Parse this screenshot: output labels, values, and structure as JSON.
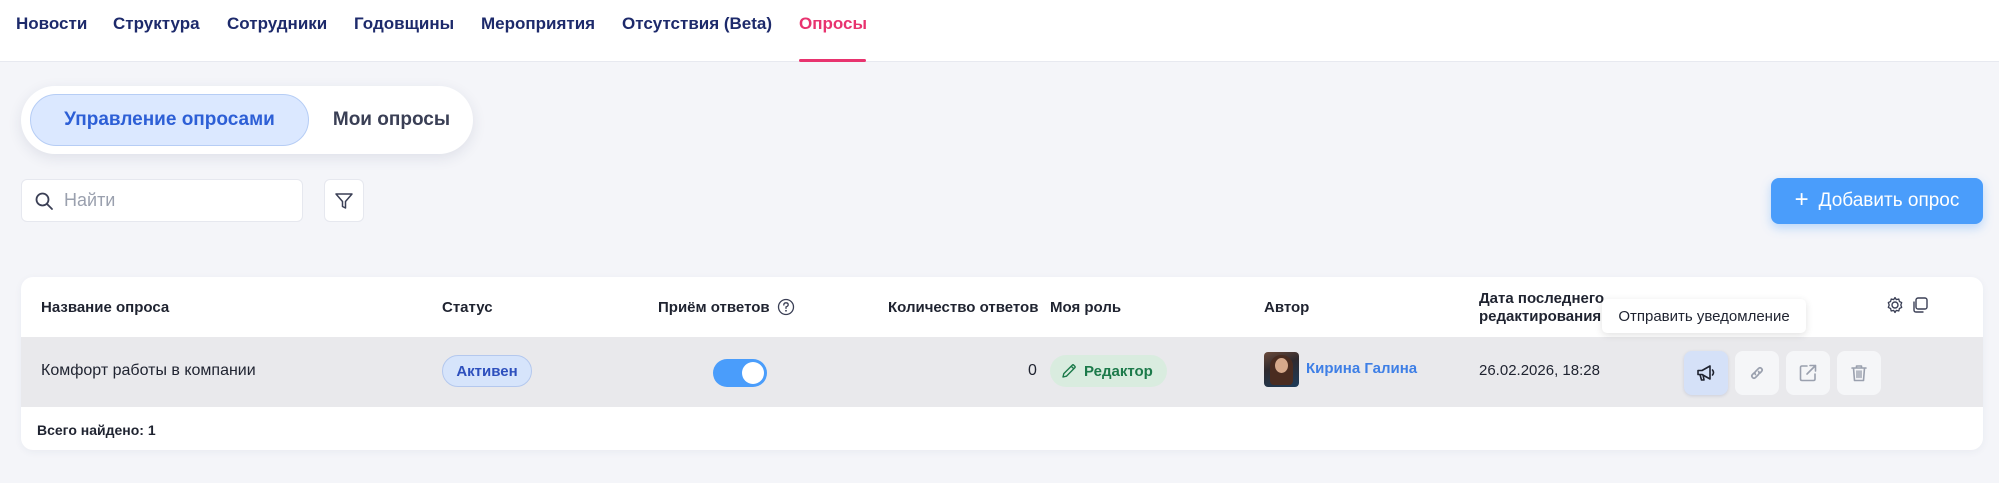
{
  "topnav": {
    "items": [
      {
        "label": "Новости"
      },
      {
        "label": "Структура"
      },
      {
        "label": "Сотрудники"
      },
      {
        "label": "Годовщины"
      },
      {
        "label": "Мероприятия"
      },
      {
        "label": "Отсутствия (Beta)"
      },
      {
        "label": "Опросы",
        "active": true
      }
    ],
    "active_color": "#e8336f",
    "text_color": "#1d2a6b"
  },
  "segmented": {
    "active_label": "Управление опросами",
    "inactive_label": "Мои опросы"
  },
  "search": {
    "placeholder": "Найти",
    "value": ""
  },
  "toolbar": {
    "add_label": "Добавить опрос",
    "add_color": "#4a9dfb"
  },
  "table": {
    "headers": {
      "name": "Название опроса",
      "status": "Статус",
      "accepting": "Приём ответов",
      "count": "Количество ответов",
      "role": "Моя роль",
      "author": "Автор",
      "date_line1": "Дата последнего",
      "date_line2": "редактирования"
    },
    "rows": [
      {
        "name": "Комфорт работы в компании",
        "status": "Активен",
        "accepting": true,
        "count": "0",
        "role": "Редактор",
        "author": "Кирина Галина",
        "date": "26.02.2026, 18:28"
      }
    ],
    "footer": "Всего найдено: 1"
  },
  "tooltip": {
    "text": "Отправить уведомление"
  },
  "icons": {
    "search": "search-icon",
    "filter": "filter-icon",
    "help": "help-circle-icon",
    "settings": "gear-icon",
    "columns": "copy-columns-icon",
    "pencil": "pencil-icon",
    "megaphone": "megaphone-icon",
    "link": "link-icon",
    "external": "external-link-icon",
    "trash": "trash-icon"
  }
}
